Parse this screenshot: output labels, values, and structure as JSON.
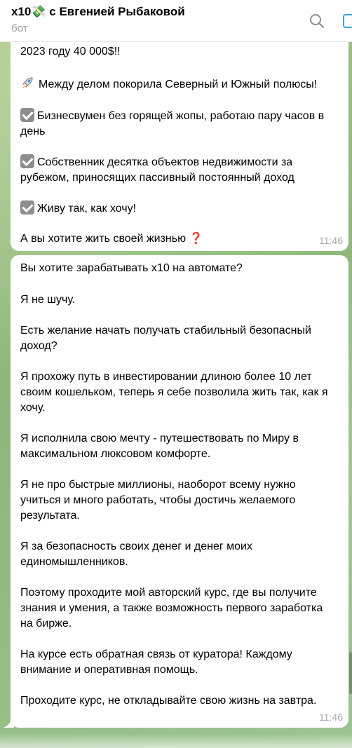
{
  "header": {
    "title_prefix": "x10",
    "title_money": "💸",
    "title_suffix": " с Евгенией Рыбаковой",
    "subtitle": "бот"
  },
  "message1": {
    "lines": [
      "2023 году 40 000$!!",
      "Между делом покорила Северный и Южный полюсы!",
      "Бизнесвумен без горящей жопы, работаю пару часов в",
      "день",
      "Собственник десятка объектов недвижимости за",
      "рубежом, приносящих пассивный постоянный доход",
      "Живу так, как хочу!",
      "А вы хотите жить своей жизнью",
      "❓"
    ],
    "time": "11:46"
  },
  "message2": {
    "lines": [
      "Вы хотите зарабатывать х10 на автомате?",
      "Я не шучу.",
      "Есть желание начать получать стабильный безопасный",
      "доход?",
      "Я прохожу путь в инвестировании длиною более 10 лет",
      "своим кошельком, теперь я себе позволила жить так, как я",
      "хочу.",
      "Я исполнила свою мечту - путешествовать по Миру в",
      "максимальном люксовом комфорте.",
      "Я не про быстрые миллионы, наоборот всему нужно",
      "учиться и много работать, чтобы достичь желаемого",
      "результата.",
      "Я за безопасность своих денег и денег моих",
      "единомышленников.",
      "Поэтому проходите мой авторский курс, где вы получите",
      "знания и умения, а также возможность первого заработка",
      "на бирже.",
      "На курсе есть обратная связь от куратора! Каждому",
      "внимание и оперативная помощь.",
      "Проходите курс, не откладывайте свою жизнь на завтра."
    ],
    "time": "11:46"
  },
  "icons": {
    "search": "search-icon",
    "more": "more-icon",
    "rocket": "rocket-icon",
    "check": "check-box-icon"
  },
  "colors": {
    "accent": "#3ba0e6",
    "bubble": "#ffffff",
    "wallpaper": "#8fb97a"
  }
}
